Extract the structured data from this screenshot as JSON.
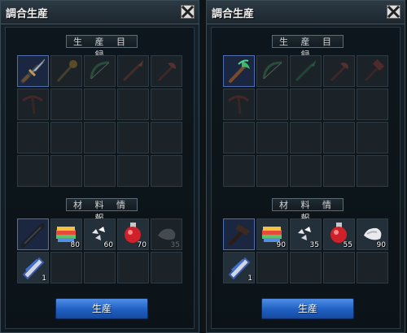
{
  "left": {
    "title": "調合生産",
    "catalog_label": "生 産 目 録",
    "materials_label": "材 料 情 報",
    "produce_label": "生産",
    "catalog_icons": [
      "dagger-icon",
      "staff-icon",
      "bow-icon",
      "spear-icon",
      "axe-icon",
      "crossbow-icon"
    ],
    "materials": [
      {
        "icon": "dark-dagger-icon",
        "count": ""
      },
      {
        "icon": "rainbow-gem-icon",
        "count": "80"
      },
      {
        "icon": "crystal-shards-icon",
        "count": "60"
      },
      {
        "icon": "red-potion-icon",
        "count": "70"
      },
      {
        "icon": "grey-ore-icon",
        "count": "35"
      },
      {
        "icon": "blue-scroll-icon",
        "count": "1"
      }
    ]
  },
  "right": {
    "title": "調合生産",
    "catalog_label": "生 産 目 録",
    "materials_label": "材 料 情 報",
    "produce_label": "生産",
    "catalog_icons": [
      "green-staff-icon",
      "bow-icon",
      "spear-icon",
      "axe-icon",
      "hammer-icon",
      "crossbow-icon"
    ],
    "materials": [
      {
        "icon": "dark-hammer-icon",
        "count": ""
      },
      {
        "icon": "rainbow-gem-icon",
        "count": "90"
      },
      {
        "icon": "crystal-shards-icon",
        "count": "35"
      },
      {
        "icon": "red-potion-icon",
        "count": "55"
      },
      {
        "icon": "white-ore-icon",
        "count": "90"
      },
      {
        "icon": "blue-scroll-icon",
        "count": "1"
      }
    ]
  }
}
